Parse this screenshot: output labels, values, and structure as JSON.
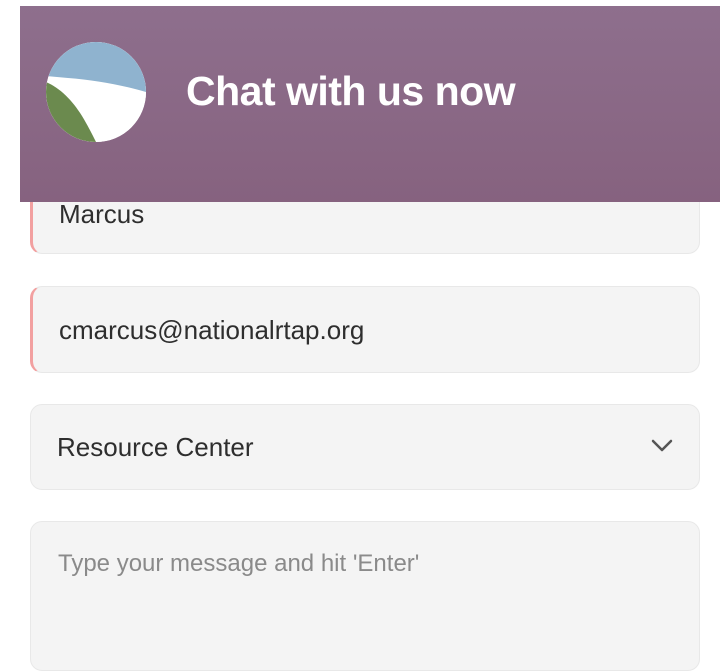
{
  "header": {
    "title": "Chat with us now",
    "logo_icon": "landscape-logo-icon"
  },
  "form": {
    "name_value": "Marcus",
    "email_value": "cmarcus@nationalrtap.org",
    "department_selected": "Resource Center",
    "message_placeholder": "Type your message and hit 'Enter'"
  },
  "colors": {
    "header_bg": "#8a6886",
    "field_bg": "#f4f4f4",
    "invalid_accent": "#f2a0a0",
    "logo_sky": "#8fb3cf",
    "logo_green": "#6b8a4e"
  }
}
